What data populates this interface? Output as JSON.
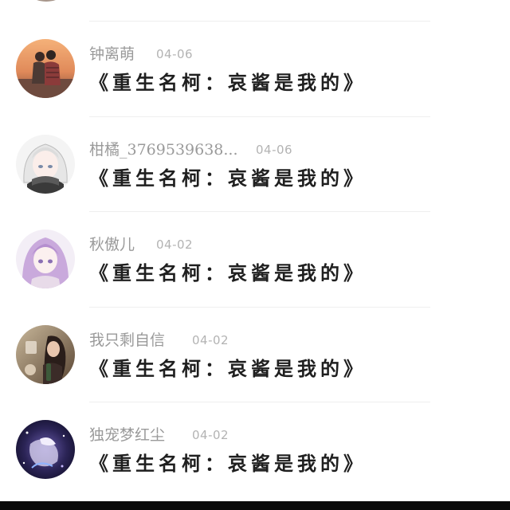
{
  "comments": [
    {
      "username": "钟离萌",
      "date": "04-06",
      "title": "《重生名柯：哀酱是我的》",
      "avatar_icon": "couple-sunset-avatar"
    },
    {
      "username": "柑橘_3769539638...",
      "date": "04-06",
      "title": "《重生名柯：哀酱是我的》",
      "avatar_icon": "anime-white-hair-avatar"
    },
    {
      "username": "秋傲儿",
      "date": "04-02",
      "title": "《重生名柯：哀酱是我的》",
      "avatar_icon": "anime-purple-hair-avatar"
    },
    {
      "username": "我只剩自信",
      "date": "04-02",
      "title": "《重生名柯：哀酱是我的》",
      "avatar_icon": "girl-photo-avatar"
    },
    {
      "username": "独宠梦红尘",
      "date": "04-02",
      "title": "《重生名柯：哀酱是我的》",
      "avatar_icon": "anime-galaxy-avatar"
    }
  ],
  "colors": {
    "username": "#9a9a9a",
    "date": "#b3b3b3",
    "title": "#1f1f1f",
    "divider": "#efefef"
  }
}
